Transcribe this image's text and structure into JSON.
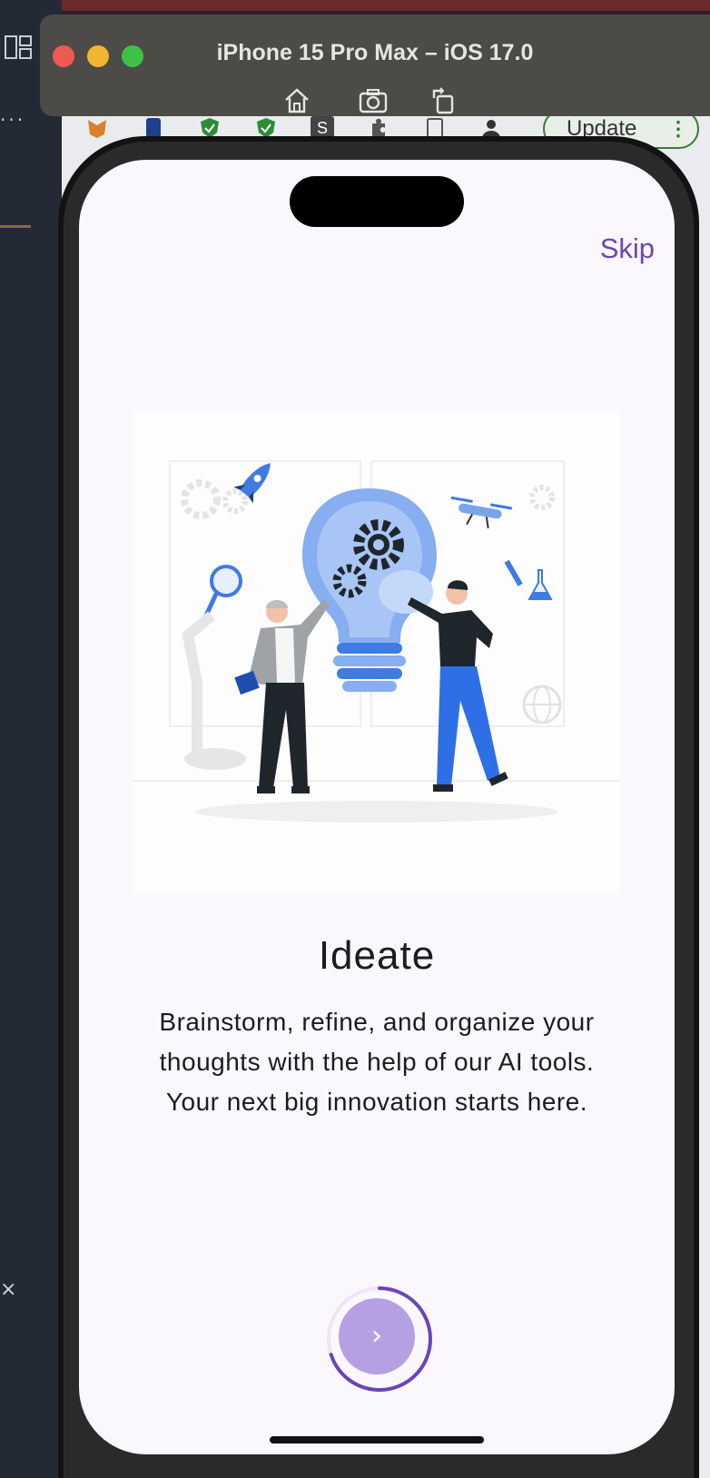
{
  "simulator": {
    "title": "iPhone 15 Pro Max – iOS 17.0",
    "tools": [
      "home-icon",
      "screenshot-icon",
      "rotate-icon"
    ]
  },
  "browser": {
    "update_label": "Update",
    "extension_letter": "S"
  },
  "onboarding": {
    "skip_label": "Skip",
    "title": "Ideate",
    "description": "Brainstorm, refine, and organize your thoughts with the help of our AI tools. Your next big innovation starts here.",
    "next_label": "›",
    "progress": 0.7
  },
  "colors": {
    "accent": "#6b45b8",
    "next_button": "#b4a0e2",
    "screen_bg": "#fbf8fd",
    "illustration_blue": "#3f7be0"
  }
}
